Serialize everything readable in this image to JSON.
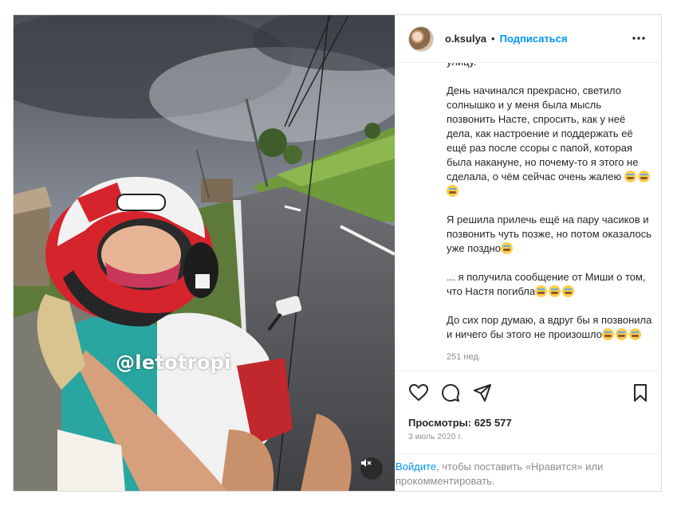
{
  "post": {
    "watermark": "@letotropi",
    "media_icons": {
      "mute": "speaker-muted-icon"
    }
  },
  "header": {
    "username": "o.ksulya",
    "separator": "•",
    "follow_label": "Подписаться",
    "more_icon": "more-horizontal-icon"
  },
  "caption": {
    "partial_top": "улицу.",
    "paragraphs": [
      "День начинался прекрасно, светило солнышко и у меня была мысль позвонить Насте, спросить, как у неё дела, как настроение и поддержать её ещё раз после ссоры с папой, которая была накануне, но почему-то я этого не сделала, о чём сейчас очень жалею",
      "Я решила прилечь ещё на пару часиков и позвонить чуть позже, но потом оказалось уже поздно",
      "... я получила сообщение от Миши о том, что Настя погибла",
      "До сих пор думаю, а вдруг бы я позвонила и ничего бы этого не произошло"
    ],
    "emoji_counts": [
      3,
      1,
      3,
      3
    ],
    "age": "251 нед."
  },
  "actions": {
    "icons": [
      "heart-icon",
      "comment-icon",
      "share-icon",
      "bookmark-icon"
    ],
    "views_label": "Просмотры: 625 577",
    "date": "3 июль 2020 г."
  },
  "login_prompt": {
    "link": "Войдите",
    "rest": ", чтобы поставить «Нравится» или прокомментировать."
  },
  "colors": {
    "accent": "#0095f6",
    "text": "#262626",
    "muted": "#8e8e8e",
    "border": "#dbdbdb"
  }
}
